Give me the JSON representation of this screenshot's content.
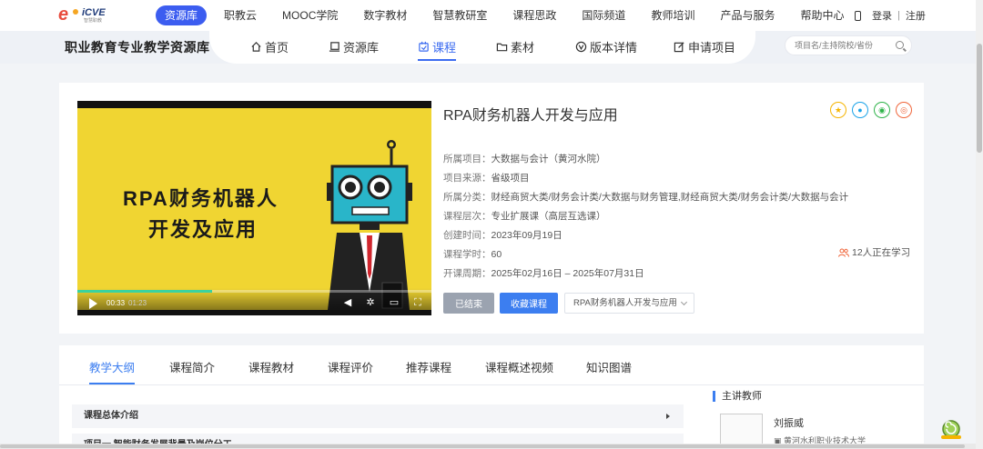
{
  "logo": {
    "brand": "iCVE",
    "sub": "智慧职教"
  },
  "topnav": {
    "items": [
      "资源库",
      "职教云",
      "MOOC学院",
      "数字教材",
      "智慧教研室",
      "课程思政",
      "国际频道",
      "教师培训",
      "产品与服务",
      "帮助中心"
    ],
    "active": "资源库",
    "login": "登录",
    "register": "注册",
    "separator": "|"
  },
  "subnav": {
    "site_title": "职业教育专业教学资源库",
    "items": [
      "首页",
      "资源库",
      "课程",
      "素材",
      "版本详情",
      "申请项目"
    ],
    "active": "课程",
    "search_placeholder": "项目名/主持院校/省份"
  },
  "course": {
    "title": "RPA财务机器人开发与应用",
    "video": {
      "title_line1": "RPA财务机器人",
      "title_line2": "开发及应用",
      "current_time": "00:33",
      "duration": "01:23",
      "progress": 0.38
    },
    "info": [
      {
        "label": "所属项目：",
        "value": "大数据与会计（黄河水院）"
      },
      {
        "label": "项目来源：",
        "value": "省级项目"
      },
      {
        "label": "所属分类：",
        "value": "财经商贸大类/财务会计类/大数据与财务管理,财经商贸大类/财务会计类/大数据与会计"
      },
      {
        "label": "课程层次：",
        "value": "专业扩展课（高层互选课）"
      },
      {
        "label": "创建时间：",
        "value": "2023年09月19日"
      },
      {
        "label": "课程学时：",
        "value": "60"
      },
      {
        "label": "开课周期：",
        "value": "2025年02月16日 – 2025年07月31日"
      }
    ],
    "learners": "12人正在学习",
    "btn_ended": "已结束",
    "btn_fav": "收藏课程",
    "version_select": "RPA财务机器人开发与应用"
  },
  "tabs": {
    "items": [
      "教学大纲",
      "课程简介",
      "课程教材",
      "课程评价",
      "推荐课程",
      "课程概述视频",
      "知识图谱"
    ],
    "active": "教学大纲"
  },
  "outline": {
    "section1": "课程总体介绍",
    "section2": "项目一 智能财务发展背景及岗位分工"
  },
  "teacher": {
    "heading": "主讲教师",
    "name": "刘振威",
    "school": "黄河水利职业技术大学"
  },
  "colors": {
    "primary": "#3c7ef0",
    "nav_active": "#3c5df0",
    "video_bg": "#f0d532"
  }
}
